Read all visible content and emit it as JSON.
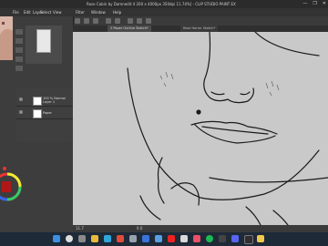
{
  "window": {
    "title": "Rose Cabin by Damnedit 4 200 x 4000px 350dpi 11.74%] - CLIP STUDIO PAINT EX",
    "controls": [
      "—",
      "❐",
      "✕"
    ]
  },
  "menu": [
    "File",
    "Edit",
    "Layer",
    "Select",
    "View",
    "Filter",
    "Window",
    "Help"
  ],
  "tabs": [
    {
      "label": "2 Paper Outline Sketch*"
    },
    {
      "label": "Rose Horror Sketch*"
    }
  ],
  "layers": [
    {
      "name": "100 % Normal",
      "sub": "Layer 1"
    },
    {
      "name": "Paper",
      "sub": ""
    }
  ],
  "status": {
    "zoom": "11.7",
    "coords": "0.0"
  },
  "colors": {
    "canvas_bg": "#c9c9c9",
    "line": "#1a1a1a",
    "panel": "#3d3d3d",
    "taskbar": "#1e2a38"
  },
  "taskbar_icons": [
    "windows-icon",
    "search-icon",
    "task-view-icon",
    "explorer-icon",
    "edge-icon",
    "chrome-icon",
    "settings-icon",
    "mail-icon",
    "photos-icon",
    "youtube-icon",
    "clip-studio-icon",
    "music-icon",
    "spotify-icon",
    "store-icon",
    "discord-icon",
    "obs-icon",
    "notes-icon"
  ]
}
